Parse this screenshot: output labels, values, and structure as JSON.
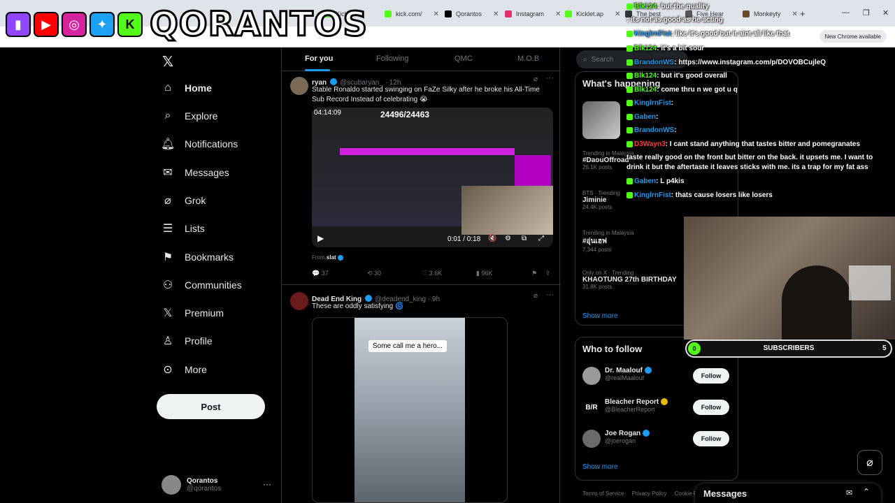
{
  "browser": {
    "tabs": [
      {
        "label": "Kick",
        "color": "#53fc18"
      },
      {
        "label": "kick.com/",
        "color": "#53fc18"
      },
      {
        "label": "Qorantos",
        "color": "#000000"
      },
      {
        "label": "Instagram",
        "color": "#e1306c"
      },
      {
        "label": "Kicklet.ap",
        "color": "#53fc18"
      },
      {
        "label": "The best",
        "color": "#333333"
      },
      {
        "label": "Five Hear",
        "color": "#555555"
      },
      {
        "label": "Monkeyty",
        "color": "#6a4a2a"
      }
    ],
    "new_chrome": "New Chrome available"
  },
  "overlay_logo": {
    "name": "QORANTOS"
  },
  "nav": {
    "items": [
      {
        "label": "Home",
        "icon": "home-icon"
      },
      {
        "label": "Explore",
        "icon": "search-icon"
      },
      {
        "label": "Notifications",
        "icon": "bell-icon"
      },
      {
        "label": "Messages",
        "icon": "envelope-icon"
      },
      {
        "label": "Grok",
        "icon": "grok-icon"
      },
      {
        "label": "Lists",
        "icon": "list-icon"
      },
      {
        "label": "Bookmarks",
        "icon": "bookmark-icon"
      },
      {
        "label": "Communities",
        "icon": "people-icon"
      },
      {
        "label": "Premium",
        "icon": "x-icon"
      },
      {
        "label": "Profile",
        "icon": "person-icon"
      },
      {
        "label": "More",
        "icon": "more-circle-icon"
      }
    ],
    "post_label": "Post",
    "profile": {
      "name": "Qorantos",
      "handle": "@qorantos"
    }
  },
  "feed": {
    "tabs": [
      "For you",
      "Following",
      "QMC",
      "M.O.B"
    ],
    "tweets": [
      {
        "name": "ryan",
        "handle": "@scubaryan_ · 12h",
        "text": "Stable Ronaldo started swinging on FaZe Silky after he broke his All-Time Sub Record Instead of celebrating 😭",
        "video_timer": "04:14:09",
        "video_counter": "24496/24463",
        "video_time": "0:01 / 0:18",
        "from": "From",
        "from_name": "slat",
        "replies": "37",
        "reposts": "30",
        "likes": "3.6K",
        "views": "96K"
      },
      {
        "name": "Dead End King",
        "handle": "@deadend_king · 9h",
        "text": "These are oddly satisfying 🌀",
        "video_caption": "Some call me a hero..."
      }
    ]
  },
  "right": {
    "search_placeholder": "Search",
    "whats_happening": "What's happening",
    "trends": [
      {
        "context": "Trending in Malaysia",
        "topic": "#DaouOffroad",
        "posts": "26.1K posts"
      },
      {
        "context": "BTS · Trending",
        "topic": "Jiminie",
        "posts": "24.4K posts"
      },
      {
        "context": "Trending in Malaysia",
        "topic": "#อุ่นเฮฟ",
        "posts": "7,344 posts"
      },
      {
        "context": "Only on X · Trending",
        "topic": "KHAOTUNG 27th BIRTHDAY",
        "posts": "31.8K posts"
      }
    ],
    "show_more": "Show more",
    "who_to_follow": "Who to follow",
    "follow_suggestions": [
      {
        "name": "Dr. Maalouf",
        "handle": "@realMaalouf"
      },
      {
        "name": "Bleacher Report",
        "handle": "@BleacherReport"
      },
      {
        "name": "Joe Rogan",
        "handle": "@joerogan"
      }
    ],
    "follow_label": "Follow",
    "footer": [
      "Terms of Service",
      "Privacy Policy",
      "Cookie P"
    ],
    "messages_title": "Messages"
  },
  "chat": [
    {
      "user": "Blk124",
      "msg": ": but the quality",
      "color": "#53fc18"
    },
    {
      "user": "",
      "msg": ": its not as good as he acting",
      "color": "#53fc18"
    },
    {
      "user": "KinglrnFist",
      "msg": ": like it's good but it aint all like that",
      "color": "#1d9bf0"
    },
    {
      "user": "Blk124",
      "msg": ": it's a bit sour",
      "color": "#53fc18"
    },
    {
      "user": "BrandonWS",
      "msg": ": https://www.instagram.com/p/DOVOBCujleQ",
      "color": "#1d9bf0"
    },
    {
      "user": "Blk124",
      "msg": ": but it's good overall",
      "color": "#53fc18"
    },
    {
      "user": "Blk124",
      "msg": ": come thru n we got u q",
      "color": "#53fc18"
    },
    {
      "user": "KinglrnFist",
      "msg": ":",
      "color": "#1d9bf0"
    },
    {
      "user": "Gaben",
      "msg": ":",
      "color": "#1d9bf0"
    },
    {
      "user": "BrandonWS",
      "msg": ":",
      "color": "#1d9bf0"
    },
    {
      "user": "D3Wayn3",
      "msg": ": I cant stand anything that tastes bitter and pomegranates",
      "color": "#ff3b3b"
    },
    {
      "user": "",
      "msg": "taste really good on the front but bitter on the back. it upsets me. I want to",
      "color": "#ffffff"
    },
    {
      "user": "",
      "msg": "drink it but the aftertaste it leaves sticks with me. its a trap for my fat ass",
      "color": "#ffffff"
    },
    {
      "user": "Gaben",
      "msg": ": L p4kis",
      "color": "#1d9bf0"
    },
    {
      "user": "KinglrnFist",
      "msg": ": thats cause losers like losers",
      "color": "#1d9bf0"
    }
  ],
  "subs_bar": {
    "label": "SUBSCRIBERS",
    "current": "0",
    "goal": "5",
    "progress": 0.0
  }
}
